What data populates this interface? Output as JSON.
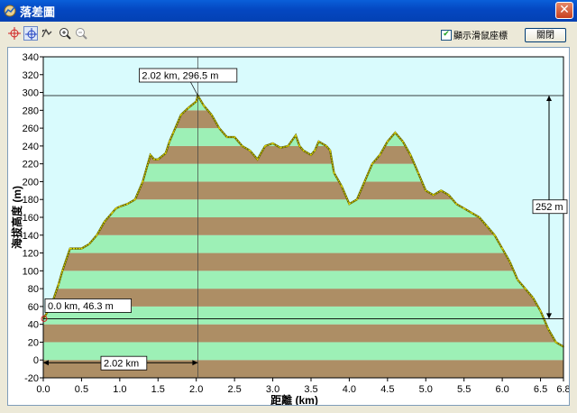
{
  "window": {
    "title": "落差圖",
    "close_label": "✕"
  },
  "toolbar": {
    "checkbox_label": "顯示滑鼠座標",
    "checkbox_checked": true,
    "close_button_label": "關閉"
  },
  "colors": {
    "band_a": "#ad8e65",
    "band_b": "#9df0b6",
    "plot_bg": "#d9fbfd",
    "line": "#c9c600"
  },
  "chart_data": {
    "type": "area",
    "xlabel": "距離 (km)",
    "ylabel": "海拔高度 (m)",
    "xlim": [
      0,
      6.8
    ],
    "ylim": [
      -20,
      340
    ],
    "x_ticks": [
      "0.0",
      "0.5",
      "1.0",
      "1.5",
      "2.0",
      "2.5",
      "3.0",
      "3.5",
      "4.0",
      "4.5",
      "5.0",
      "5.5",
      "6.0",
      "6.5",
      "6.8"
    ],
    "x_tick_values": [
      0,
      0.5,
      1,
      1.5,
      2,
      2.5,
      3,
      3.5,
      4,
      4.5,
      5,
      5.5,
      6,
      6.5,
      6.8
    ],
    "y_ticks": [
      "-20",
      "0",
      "20",
      "40",
      "60",
      "80",
      "100",
      "120",
      "140",
      "160",
      "180",
      "200",
      "220",
      "240",
      "260",
      "280",
      "300",
      "320",
      "340"
    ],
    "y_tick_values": [
      -20,
      0,
      20,
      40,
      60,
      80,
      100,
      120,
      140,
      160,
      180,
      200,
      220,
      240,
      260,
      280,
      300,
      320,
      340
    ],
    "x": [
      0.0,
      0.1,
      0.2,
      0.25,
      0.35,
      0.4,
      0.5,
      0.6,
      0.7,
      0.8,
      0.9,
      0.95,
      1.0,
      1.1,
      1.2,
      1.3,
      1.4,
      1.45,
      1.5,
      1.6,
      1.65,
      1.7,
      1.8,
      1.9,
      2.0,
      2.02,
      2.1,
      2.2,
      2.3,
      2.4,
      2.5,
      2.6,
      2.7,
      2.8,
      2.9,
      3.0,
      3.1,
      3.2,
      3.3,
      3.35,
      3.4,
      3.5,
      3.55,
      3.6,
      3.7,
      3.75,
      3.8,
      3.9,
      4.0,
      4.1,
      4.2,
      4.3,
      4.4,
      4.5,
      4.6,
      4.7,
      4.8,
      4.9,
      5.0,
      5.1,
      5.2,
      5.3,
      5.4,
      5.5,
      5.6,
      5.7,
      5.8,
      5.9,
      6.0,
      6.1,
      6.2,
      6.3,
      6.4,
      6.5,
      6.6,
      6.7,
      6.8
    ],
    "y": [
      46.3,
      60,
      85,
      100,
      125,
      125,
      125,
      130,
      140,
      155,
      165,
      170,
      172,
      175,
      180,
      200,
      230,
      225,
      225,
      232,
      245,
      255,
      275,
      283,
      290,
      296.5,
      285,
      275,
      260,
      250,
      250,
      240,
      235,
      225,
      240,
      243,
      238,
      240,
      252,
      240,
      235,
      230,
      235,
      245,
      240,
      235,
      210,
      195,
      175,
      180,
      200,
      220,
      230,
      245,
      255,
      245,
      230,
      210,
      190,
      185,
      190,
      185,
      175,
      170,
      165,
      160,
      150,
      140,
      125,
      110,
      90,
      80,
      70,
      55,
      35,
      20,
      15
    ],
    "annotations": {
      "peak_label": "2.02 km, 296.5 m",
      "start_label": "0.0 km, 46.3 m",
      "distance_label": "2.02 km",
      "height_diff_label": "252 m"
    },
    "peak": {
      "x": 2.02,
      "y": 296.5
    },
    "start": {
      "x": 0.0,
      "y": 46.3
    },
    "grid": false,
    "band_step": 20
  }
}
